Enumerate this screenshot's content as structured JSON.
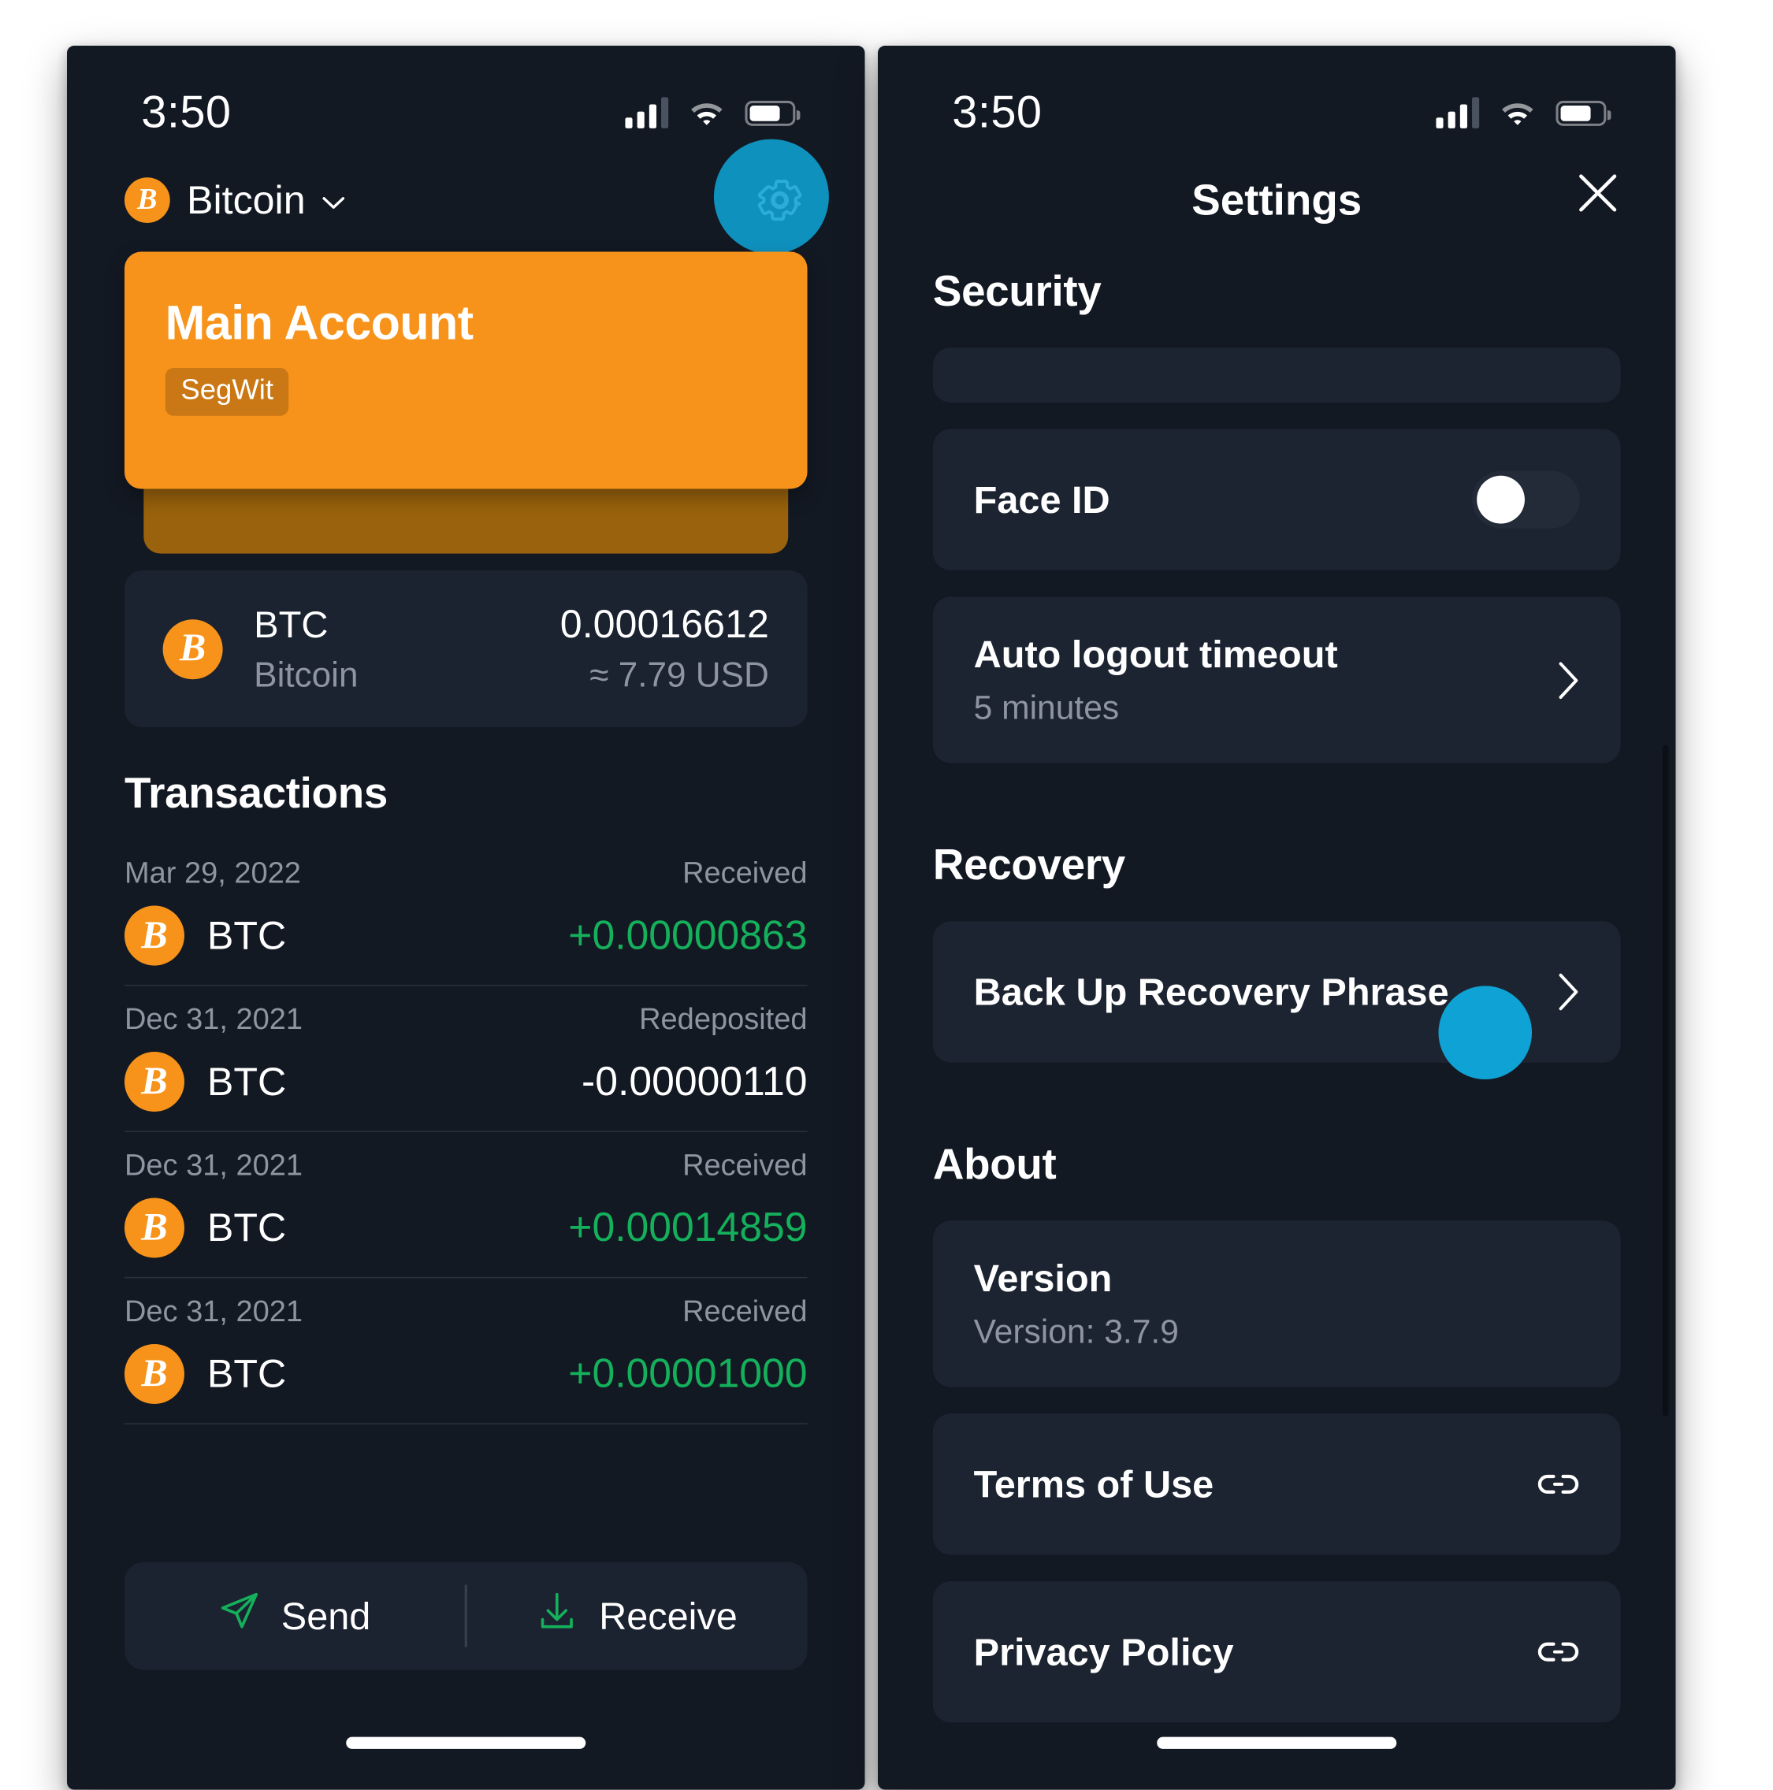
{
  "wallet": {
    "status": {
      "time": "3:50",
      "signal_icon": "cellular-signal-icon",
      "wifi_icon": "wifi-icon",
      "battery_icon": "battery-icon"
    },
    "coin_selector": {
      "label": "Bitcoin",
      "icon": "bitcoin-icon",
      "chevron": "chevron-down-icon"
    },
    "settings_button": {
      "icon": "gear-icon"
    },
    "account_card": {
      "title": "Main Account",
      "chip": "SegWit"
    },
    "balance": {
      "icon": "bitcoin-icon",
      "symbol": "BTC",
      "name": "Bitcoin",
      "amount": "0.00016612",
      "fiat": "≈ 7.79 USD"
    },
    "transactions_heading": "Transactions",
    "transactions": [
      {
        "date": "Mar 29, 2022",
        "status": "Received",
        "symbol": "BTC",
        "amount": "+0.00000863",
        "sign": "pos"
      },
      {
        "date": "Dec 31, 2021",
        "status": "Redeposited",
        "symbol": "BTC",
        "amount": "-0.00000110",
        "sign": "neg"
      },
      {
        "date": "Dec 31, 2021",
        "status": "Received",
        "symbol": "BTC",
        "amount": "+0.00014859",
        "sign": "pos"
      },
      {
        "date": "Dec 31, 2021",
        "status": "Received",
        "symbol": "BTC",
        "amount": "+0.00001000",
        "sign": "pos"
      }
    ],
    "actions": {
      "send_label": "Send",
      "send_icon": "send-paper-plane-icon",
      "receive_label": "Receive",
      "receive_icon": "receive-download-icon"
    }
  },
  "settings": {
    "status": {
      "time": "3:50",
      "signal_icon": "cellular-signal-icon",
      "wifi_icon": "wifi-icon",
      "battery_icon": "battery-icon"
    },
    "title": "Settings",
    "close_icon": "close-icon",
    "sections": {
      "security": {
        "heading": "Security",
        "face_id": {
          "label": "Face ID",
          "toggle_state": "off"
        },
        "auto_logout": {
          "label": "Auto logout timeout",
          "value": "5 minutes",
          "chevron": "chevron-right-icon"
        }
      },
      "recovery": {
        "heading": "Recovery",
        "backup": {
          "label": "Back Up Recovery Phrase",
          "chevron": "chevron-right-icon"
        }
      },
      "about": {
        "heading": "About",
        "version": {
          "label": "Version",
          "value": "Version: 3.7.9"
        },
        "terms": {
          "label": "Terms of Use",
          "icon": "link-icon"
        },
        "privacy": {
          "label": "Privacy Policy",
          "icon": "link-icon"
        }
      }
    }
  },
  "colors": {
    "background": "#131923",
    "card": "#1c2431",
    "accent_orange": "#f7931a",
    "accent_green": "#14b05b",
    "click_indicator": "#0fa2d4",
    "muted_text": "#8e95a1"
  }
}
